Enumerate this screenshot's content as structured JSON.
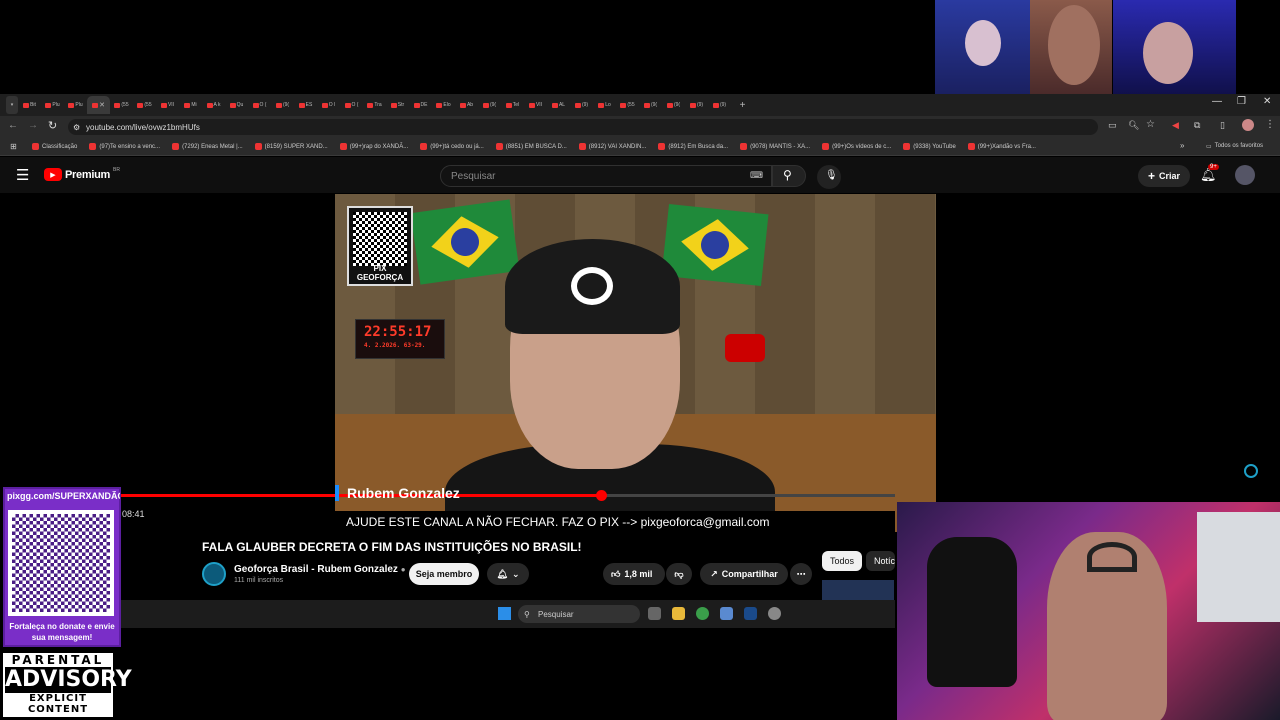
{
  "browser": {
    "tabs": [
      "Bit",
      "Plu",
      "Plu",
      "",
      "(55",
      "(55",
      "VII",
      "Mi",
      "A k",
      "Qu",
      "O (",
      "(9(",
      "ES",
      "O l",
      "O (",
      "Tra",
      "Str",
      "DE",
      "Elo",
      "Ab",
      "(9(",
      "Tel",
      "VII",
      "AL",
      "(9)",
      "Lo",
      "(55",
      "(9(",
      "(9(",
      "(9)",
      "(9)"
    ],
    "url": "youtube.com/live/ovwz1bmHUfs",
    "bookmarks": [
      "Classificação",
      "(97)Te ensino a venc...",
      "(7292) Eneas Metal |...",
      "(8159) SUPER XAND...",
      "(99+)rap do XANDÃ...",
      "(99+)tá cedo ou já...",
      "(8851) EM BUSCA D...",
      "(8912) VAI XANDIN...",
      "(8912) Em Busca da...",
      "(9078) MANTIS - XA...",
      "(99+)Os vídeos de c...",
      "(9338) YouTube",
      "(99+)Xandão vs Fra..."
    ],
    "all_favorites": "Todos os favoritos"
  },
  "youtube": {
    "logo": "Premium",
    "logo_region": "BR",
    "search_placeholder": "Pesquisar",
    "create_label": "Criar",
    "notifications_badge": "9+"
  },
  "video": {
    "qr_label": "PIX GEOFORÇA",
    "clock_time": "22:55:17",
    "clock_date": "4. 2.2026.   63-29.",
    "name_tag": "Rubem Gonzalez",
    "ticker": "AJUDE ESTE CANAL A NÃO FECHAR. FAZ O PIX --> pixgeoforca@gmail.com",
    "timecode": "08:41",
    "progress_fraction": 0.62,
    "title": "FALA GLAUBER DECRETA O FIM DAS INSTITUIÇÕES NO BRASIL!",
    "channel": "Geoforça Brasil - Rubem Gonzalez",
    "subscribers": "111 mil inscritos",
    "join_label": "Seja membro",
    "likes": "1,8 mil",
    "share_label": "Compartilhar",
    "chips": [
      "Todos",
      "Notíci"
    ]
  },
  "taskbar": {
    "search_placeholder": "Pesquisar"
  },
  "overlay": {
    "pix_url": "pixgg.com/SUPERXANDÃO",
    "pix_message": "Fortaleça no donate e envie sua mensagem!",
    "advisory_top": "PARENTAL",
    "advisory_mid": "ADVISORY",
    "advisory_bottom": "EXPLICIT CONTENT"
  },
  "colors": {
    "youtube_red": "#ff0000",
    "pix_purple": "#7a2ec8",
    "accent_blue": "#1b8cff"
  }
}
